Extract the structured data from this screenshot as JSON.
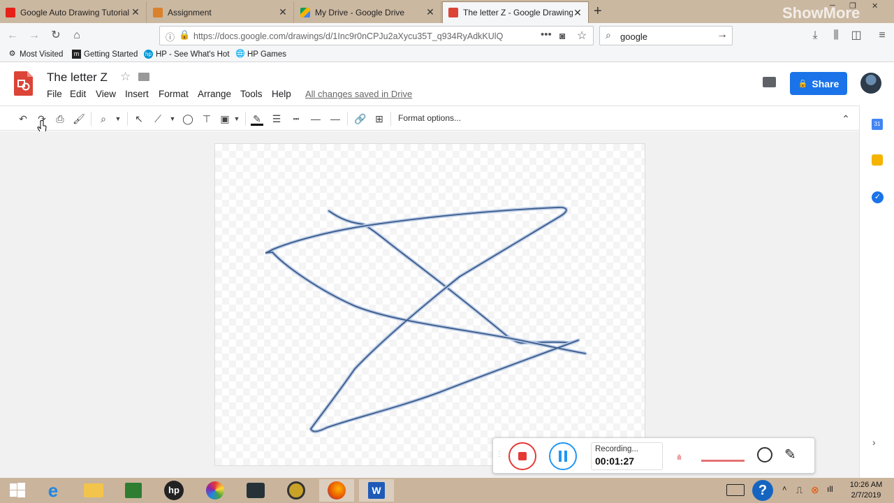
{
  "browser": {
    "tabs": [
      {
        "title": "Google Auto Drawing Tutorial f",
        "active": false
      },
      {
        "title": "Assignment",
        "active": false
      },
      {
        "title": "My Drive - Google Drive",
        "active": false
      },
      {
        "title": "The letter Z - Google Drawings",
        "active": true
      }
    ],
    "url": "https://docs.google.com/drawings/d/1Inc9r0nCPJu2aXycu35T_q934RyAdkKUlQ",
    "search_value": "google",
    "watermark": "ShowMore"
  },
  "bookmarks": [
    "Most Visited",
    "Getting Started",
    "HP - See What's Hot",
    "HP Games"
  ],
  "doc": {
    "title": "The letter Z",
    "menu": [
      "File",
      "Edit",
      "View",
      "Insert",
      "Format",
      "Arrange",
      "Tools",
      "Help"
    ],
    "save_status": "All changes saved in Drive",
    "share_label": "Share"
  },
  "toolbar": {
    "format_options": "Format options...",
    "icons": [
      "undo-icon",
      "redo-icon",
      "print-icon",
      "paint-format-icon",
      "zoom-icon",
      "select-icon",
      "line-icon",
      "shape-icon",
      "textbox-icon",
      "image-icon",
      "line-color-icon",
      "line-weight-icon",
      "line-dash-icon",
      "line-start-icon",
      "line-end-icon",
      "link-icon",
      "comment-add-icon"
    ]
  },
  "sidebar": {
    "apps": [
      "calendar-icon",
      "keep-icon",
      "tasks-icon"
    ]
  },
  "recorder": {
    "status": "Recording...",
    "time": "00:01:27"
  },
  "taskbar": {
    "time": "10:26 AM",
    "date": "2/7/2019"
  },
  "colors": {
    "share_blue": "#1a73e8",
    "stroke": "#3b5a8a",
    "record_red": "#e53935",
    "pause_blue": "#2196f3"
  }
}
